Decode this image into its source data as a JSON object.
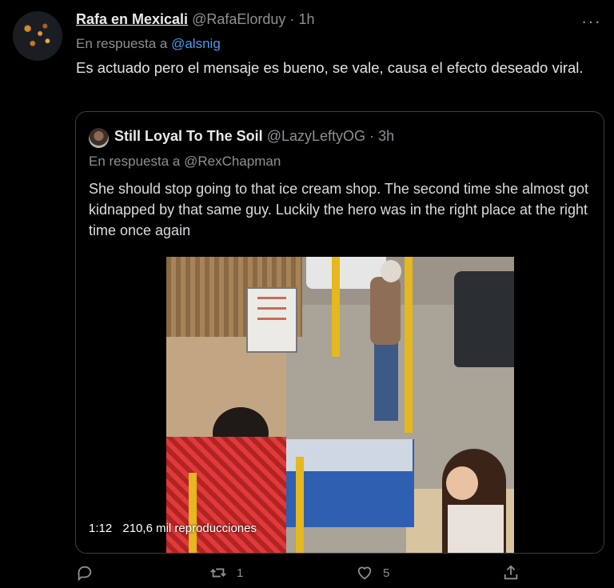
{
  "tweet": {
    "display_name": "Rafa en Mexicali",
    "handle": "@RafaElorduy",
    "separator": "·",
    "time": "1h",
    "reply_prefix": "En respuesta a",
    "reply_to": "@alsnig",
    "text": "Es actuado pero el mensaje es bueno, se vale, causa el efecto deseado viral.",
    "more_icon": "more-icon"
  },
  "quoted": {
    "display_name": "Still Loyal To The Soil",
    "handle": "@LazyLeftyOG",
    "separator": "·",
    "time": "3h",
    "reply_line": "En respuesta a @RexChapman",
    "text": "She should stop going to that ice cream shop. The second time she almost got kidnapped by that same guy. Luckily the hero was in the right place at the right time once again",
    "video": {
      "duration": "1:12",
      "views": "210,6 mil reproducciones"
    }
  },
  "actions": {
    "reply": {
      "icon": "reply-icon",
      "count": ""
    },
    "retweet": {
      "icon": "retweet-icon",
      "count": "1"
    },
    "like": {
      "icon": "heart-icon",
      "count": "5"
    },
    "share": {
      "icon": "share-icon",
      "count": ""
    }
  },
  "colors": {
    "background": "#000000",
    "text": "#e1e3e5",
    "muted": "#8b8f94",
    "link": "#4a9cec",
    "border": "#3a3d42"
  }
}
